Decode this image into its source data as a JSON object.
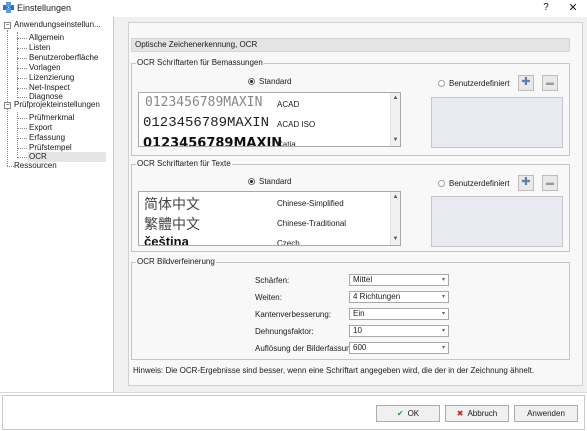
{
  "window": {
    "title": "Einstellungen",
    "help_label": "?",
    "close_label": "✕"
  },
  "tree": {
    "root1": "Anwendungseinstellun...",
    "root1_children": [
      "Allgemein",
      "Listen",
      "Benutzeroberfläche",
      "Vorlagen",
      "Lizenzierung",
      "Net-Inspect",
      "Diagnose"
    ],
    "root2": "Prüfprojekteinstellungen",
    "root2_children": [
      "Prüfmerkmal",
      "Export",
      "Erfassung",
      "Prüfstempel",
      "OCR"
    ],
    "root3": "Ressourcen",
    "selected": "OCR",
    "expander_symbol": "−"
  },
  "panel": {
    "section_title": "Optische Zeichenerkennung, OCR",
    "group_dimensions": {
      "title": "OCR Schriftarten für Bemassungen",
      "standard_label": "Standard",
      "custom_label": "Benutzerdefiniert",
      "add_symbol": "✚",
      "remove_symbol": "▬",
      "fonts": [
        {
          "sample": "0123456789MAXIN",
          "name": "ACAD"
        },
        {
          "sample": "0123456789MAXIN",
          "name": "ACAD ISO"
        },
        {
          "sample": "0123456789MAXIN",
          "name": "Catia"
        }
      ]
    },
    "group_texts": {
      "title": "OCR Schriftarten für Texte",
      "standard_label": "Standard",
      "custom_label": "Benutzerdefiniert",
      "add_symbol": "✚",
      "remove_symbol": "▬",
      "fonts": [
        {
          "sample": "简体中文",
          "name": "Chinese-Simplified"
        },
        {
          "sample": "繁體中文",
          "name": "Chinese-Traditional"
        },
        {
          "sample": "čeština",
          "name": "Czech"
        }
      ]
    },
    "group_refine": {
      "title": "OCR Bildverfeinerung",
      "fields": [
        {
          "label": "Schärfen:",
          "value": "Mittel"
        },
        {
          "label": "Weiten:",
          "value": "4 Richtungen"
        },
        {
          "label": "Kantenverbesserung:",
          "value": "Ein"
        },
        {
          "label": "Dehnungsfaktor:",
          "value": "10"
        },
        {
          "label": "Auflösung  der Bilderfassung:",
          "value": "600"
        }
      ]
    },
    "hint": "Hinweis: Die OCR-Ergebnisse sind besser, wenn eine Schriftart angegeben wird, die der in der Zeichnung ähnelt."
  },
  "footer": {
    "ok_label": "OK",
    "ok_icon": "✔",
    "cancel_label": "Abbruch",
    "cancel_icon": "✖",
    "apply_label": "Anwenden"
  },
  "colors": {
    "ok_icon": "#2e9e2e",
    "cancel_icon": "#c42b1c",
    "add_icon": "#5a7fb0"
  }
}
